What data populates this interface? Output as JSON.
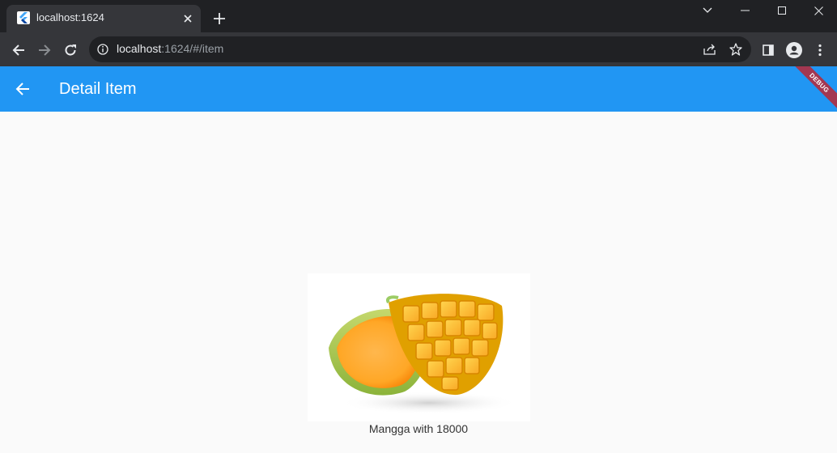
{
  "browser": {
    "tab": {
      "title": "localhost:1624"
    },
    "url": {
      "host": "localhost",
      "rest": ":1624/#/item"
    }
  },
  "app": {
    "title": "Detail Item",
    "debug_banner": "DEBUG",
    "primary_color": "#2196f3"
  },
  "item": {
    "image_icon": "mango-image",
    "caption": "Mangga with 18000"
  }
}
